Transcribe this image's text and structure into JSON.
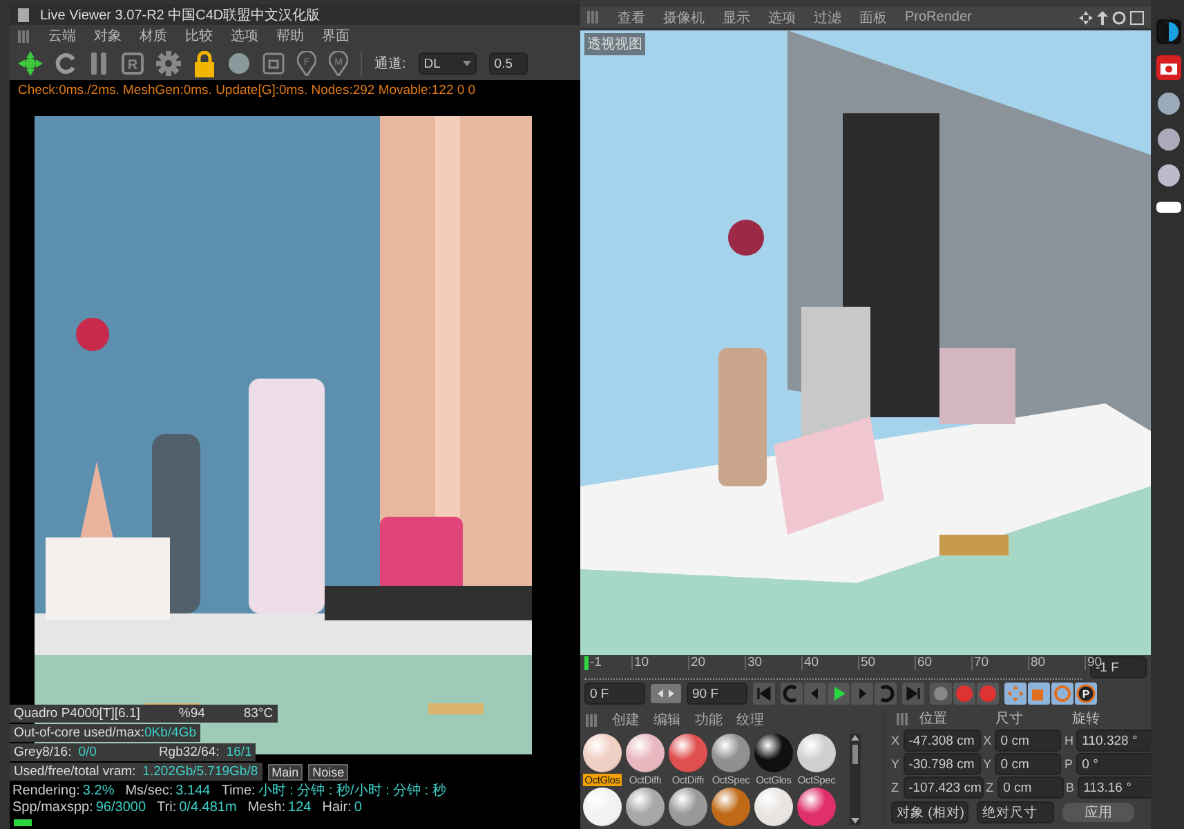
{
  "live_viewer": {
    "title": "Live Viewer 3.07-R2 中国C4D联盟中文汉化版",
    "menu": [
      "云端",
      "对象",
      "材质",
      "比较",
      "选项",
      "帮助",
      "界面"
    ],
    "toolbar": [
      {
        "kind": "logo"
      },
      {
        "kind": "reload"
      },
      {
        "kind": "pause"
      },
      {
        "kind": "letter",
        "label": "R"
      },
      {
        "kind": "gear"
      },
      {
        "kind": "lock"
      },
      {
        "kind": "sphere"
      },
      {
        "kind": "frame"
      },
      {
        "kind": "pin",
        "label": "F"
      },
      {
        "kind": "pin",
        "label": "M"
      }
    ],
    "channel_label": "通道:",
    "channel": "DL",
    "value": "0.5",
    "log": "Check:0ms./2ms. MeshGen:0ms. Update[G]:0ms. Nodes:292 Movable:122  0 0",
    "stats": {
      "gpu": "Quadro P4000[T][6.1]",
      "load": "%94",
      "temp": "83°C",
      "ooc_label": "Out-of-core used/max:",
      "ooc": "0Kb/4Gb",
      "grey_label": "Grey8/16:",
      "grey": "0/0",
      "rgb_label": "Rgb32/64:",
      "rgb": "16/1",
      "vram_label": "Used/free/total vram:",
      "vram": "1.202Gb/5.719Gb/8",
      "buttons": [
        "Main",
        "Noise"
      ]
    },
    "status_bar": [
      {
        "label": "Rendering:",
        "value": "3.2%"
      },
      {
        "label": "Ms/sec:",
        "value": "3.144"
      },
      {
        "label": "Time:",
        "value": "小时 : 分钟 : 秒/小时 : 分钟 : 秒"
      },
      {
        "label": "Spp/maxspp:",
        "value": "96/3000"
      },
      {
        "label": "Tri:",
        "value": "0/4.481m"
      },
      {
        "label": "Mesh:",
        "value": "124"
      },
      {
        "label": "Hair:",
        "value": "0"
      }
    ],
    "progress": {
      "level": 0.032
    }
  },
  "viewport": {
    "menu": [
      "查看",
      "摄像机",
      "显示",
      "选项",
      "过滤",
      "面板",
      "ProRender"
    ],
    "label": "透视视图"
  },
  "timeline": {
    "ticks": [
      "-1",
      "10",
      "20",
      "30",
      "40",
      "50",
      "60",
      "70",
      "80",
      "90"
    ],
    "current_frame": "-1 F",
    "start": "0 F",
    "end": "90 F"
  },
  "materials": {
    "menu": [
      "创建",
      "编辑",
      "功能",
      "纹理"
    ],
    "items": [
      {
        "name": "OctGlos",
        "color": "#f0d0c4",
        "selected": true
      },
      {
        "name": "OctDiffı",
        "color": "#e8b8c0",
        "selected": false
      },
      {
        "name": "OctDiffı",
        "color": "#e05050",
        "selected": false
      },
      {
        "name": "OctSpec",
        "color": "#909090",
        "selected": false
      },
      {
        "name": "OctGlos",
        "color": "#101010",
        "selected": false
      },
      {
        "name": "OctSpec",
        "color": "#d0d0d0",
        "selected": false
      },
      {
        "color": "#f2f2f2",
        "selected": false
      },
      {
        "color": "#a8a8a8",
        "selected": false
      },
      {
        "color": "#9a9a9a",
        "selected": false
      },
      {
        "color": "#c06a18",
        "selected": false
      },
      {
        "color": "#e8e4e0",
        "selected": false
      },
      {
        "color": "#e0306a",
        "selected": false
      }
    ]
  },
  "coordinates": {
    "headers": [
      "位置",
      "尺寸",
      "旋转"
    ],
    "rows": [
      {
        "axis": "X",
        "position": "-47.308 cm",
        "size_axis": "X",
        "size": "0 cm",
        "rotation_axis": "H",
        "rotation": "110.328 °"
      },
      {
        "axis": "Y",
        "position": "-30.798 cm",
        "size_axis": "Y",
        "size": "0 cm",
        "rotation_axis": "P",
        "rotation": "0 °"
      },
      {
        "axis": "Z",
        "position": "-107.423 cm",
        "size_axis": "Z",
        "size": "0 cm",
        "rotation_axis": "B",
        "rotation": "113.16 °"
      }
    ],
    "mode": "对象 (相对)",
    "size_mode": "绝对尺寸",
    "apply": "应用"
  },
  "tool_letter": "P"
}
